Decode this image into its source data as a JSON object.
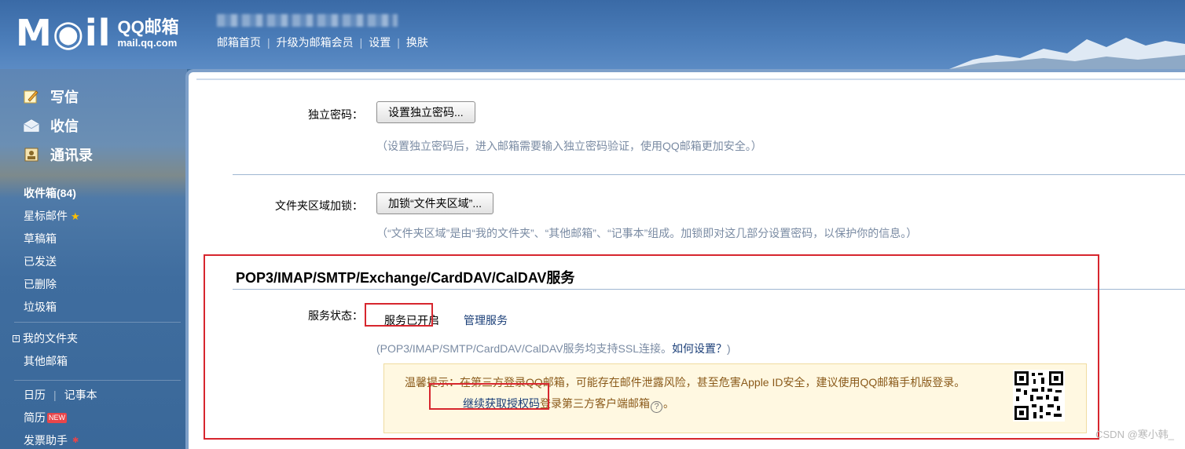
{
  "header": {
    "logo_mail": "M◉il",
    "logo_qq": "QQ邮箱",
    "logo_url": "mail.qq.com",
    "nav": [
      "邮箱首页",
      "升级为邮箱会员",
      "设置",
      "换肤"
    ]
  },
  "sidebar": {
    "actions": [
      {
        "label": "写信",
        "icon": "compose-icon"
      },
      {
        "label": "收信",
        "icon": "inbox-envelope-icon"
      },
      {
        "label": "通讯录",
        "icon": "contacts-icon"
      }
    ],
    "folders": {
      "inbox": "收件箱(84)",
      "starred": "星标邮件",
      "drafts": "草稿箱",
      "sent": "已发送",
      "deleted": "已删除",
      "trash": "垃圾箱",
      "my_folders": "我的文件夹",
      "other_mailbox": "其他邮箱",
      "calendar": "日历",
      "notepad": "记事本",
      "resume": "简历",
      "new_badge": "NEW",
      "invoice": "发票助手"
    }
  },
  "settings": {
    "independent_password": {
      "label": "独立密码：",
      "button": "设置独立密码...",
      "hint": "（设置独立密码后，进入邮箱需要输入独立密码验证，使用QQ邮箱更加安全。）"
    },
    "folder_lock": {
      "label": "文件夹区域加锁：",
      "button": "加锁“文件夹区域”...",
      "hint": "（“文件夹区域”是由“我的文件夹”、“其他邮箱”、“记事本”组成。加锁即对这几部分设置密码，以保护你的信息。）"
    },
    "service": {
      "title": "POP3/IMAP/SMTP/Exchange/CardDAV/CalDAV服务",
      "status_label": "服务状态：",
      "status_value": "服务已开启",
      "manage": "管理服务",
      "ssl_hint": "(POP3/IMAP/SMTP/CardDAV/CalDAV服务均支持SSL连接。",
      "how_to": "如何设置？",
      "ssl_hint_end": ")",
      "tip_text": "温馨提示：在第三方登录QQ邮箱，可能存在邮件泄露风险，甚至危害Apple ID安全，建议使用QQ邮箱手机版登录。",
      "tip_link": "继续获取授权码",
      "tip_link_suffix": "登录第三方客户端邮箱",
      "tip_end": "。"
    }
  },
  "watermark": "CSDN @寒小韩_",
  "colors": {
    "header_blue": "#4a7cb8",
    "link_blue": "#1b3f78",
    "annotation_red": "#d7262e",
    "tip_bg": "#fff8e1"
  }
}
